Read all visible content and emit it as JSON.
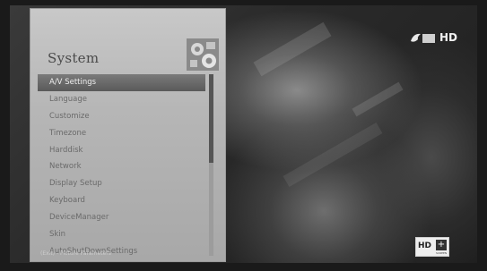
{
  "panel": {
    "title": "System",
    "icon": "settings-gears-icon",
    "menu_items": [
      "A/V Settings",
      "Language",
      "Customize",
      "Timezone",
      "Harddisk",
      "Network",
      "Display Setup",
      "Keyboard",
      "DeviceManager",
      "Skin",
      "AutoShutDownSettings"
    ],
    "selected_index": 0,
    "scroll_fraction": 0.49,
    "hint_text": "(Exit) - Picture Parameters"
  },
  "overlay": {
    "channel_logo_icon": "channel-logo-icon",
    "hd_label": "HD",
    "badge_hd": "HD",
    "badge_plus": "+",
    "badge_sub": "SCREEN"
  },
  "colors": {
    "panel_bg": "#b8b8b8",
    "selected_bg": "#666666",
    "menu_text": "#6a6a6a"
  }
}
